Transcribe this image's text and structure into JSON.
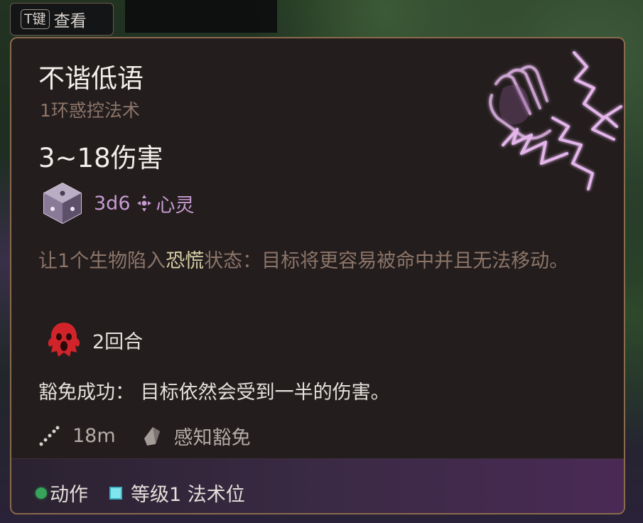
{
  "hint": {
    "key": "T键",
    "label": "查看"
  },
  "spell": {
    "name": "不谐低语",
    "level_school": "1环惑控法术",
    "damage": "3~18伤害",
    "dice": "3d6",
    "damage_type": "心灵",
    "desc_pre": "让1个生物陷入",
    "desc_highlight": "恐慌",
    "desc_post": "状态：目标将更容易被命中并且无法移动。",
    "condition_duration": "2回合",
    "save_success": "豁免成功：  目标依然会受到一半的伤害。",
    "range": "18m",
    "save_type": "感知豁免",
    "cost_action": "动作",
    "cost_slot": "等级1 法术位"
  },
  "colors": {
    "border": "#8a6a4c",
    "panel": "#231d1d",
    "psychic": "#c79bd1",
    "muted": "#8c7569",
    "highlight": "#d9d0a8",
    "action": "#37a45a",
    "slot": "#7fe6f0",
    "fear": "#d0242a"
  },
  "icons": {
    "spell_art": "hand-lightning-icon",
    "dice": "d6-dice-icon",
    "damage_type": "psychic-icon",
    "condition": "frightened-icon",
    "range": "range-icon",
    "save": "saving-throw-icon",
    "action": "action-dot-icon",
    "slot": "spell-slot-icon"
  }
}
